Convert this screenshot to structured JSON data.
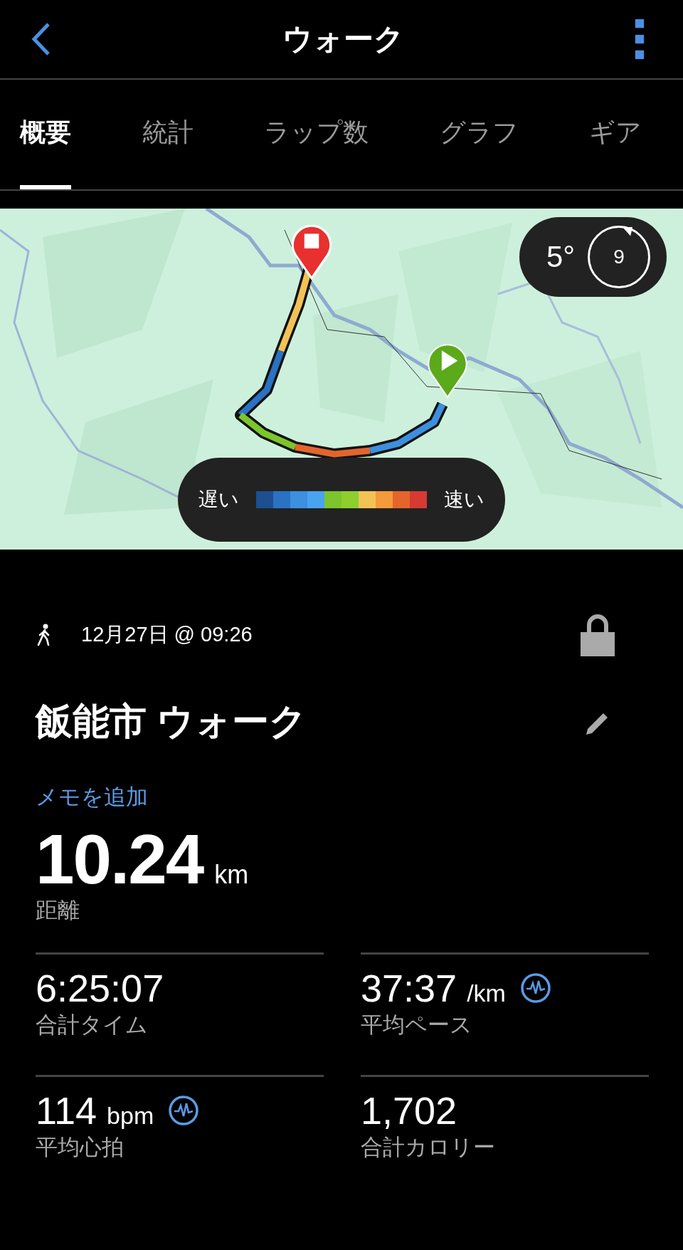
{
  "header": {
    "title": "ウォーク"
  },
  "tabs": [
    {
      "label": "概要",
      "selected": true
    },
    {
      "label": "統計",
      "selected": false
    },
    {
      "label": "ラップ数",
      "selected": false
    },
    {
      "label": "グラフ",
      "selected": false
    },
    {
      "label": "ギア",
      "selected": false
    }
  ],
  "map": {
    "temperature": "5°",
    "wind": "9",
    "legend": {
      "slow": "遅い",
      "fast": "速い"
    }
  },
  "activity": {
    "date": "12月27日 @ 09:26",
    "locked": true,
    "title": "飯能市 ウォーク",
    "add_note": "メモを追加"
  },
  "distance": {
    "value": "10.24",
    "unit": "km",
    "label": "距離"
  },
  "stats": [
    {
      "value": "6:25:07",
      "label": "合計タイム",
      "chart_icon": false
    },
    {
      "value": "37:37",
      "unit": "/km",
      "label": "平均ペース",
      "chart_icon": true
    },
    {
      "value": "114",
      "unit": "bpm",
      "label": "平均心拍",
      "chart_icon": true
    },
    {
      "value": "1,702",
      "label": "合計カロリー",
      "chart_icon": false
    }
  ]
}
